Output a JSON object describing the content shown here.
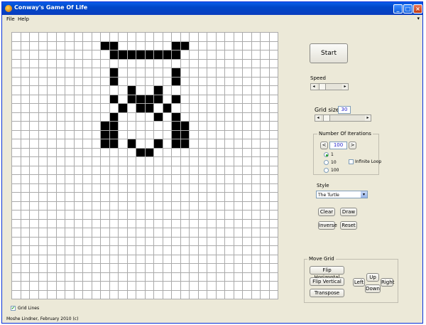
{
  "window": {
    "title": "Conway's Game Of Life"
  },
  "menu": {
    "file": "File",
    "help": "Help",
    "overflow": "▾"
  },
  "grid": {
    "size": 30,
    "alive": [
      [
        1,
        10
      ],
      [
        1,
        11
      ],
      [
        1,
        18
      ],
      [
        1,
        19
      ],
      [
        2,
        11
      ],
      [
        2,
        12
      ],
      [
        2,
        13
      ],
      [
        2,
        14
      ],
      [
        2,
        15
      ],
      [
        2,
        16
      ],
      [
        2,
        17
      ],
      [
        2,
        18
      ],
      [
        4,
        11
      ],
      [
        4,
        18
      ],
      [
        5,
        11
      ],
      [
        5,
        18
      ],
      [
        6,
        13
      ],
      [
        6,
        16
      ],
      [
        7,
        11
      ],
      [
        7,
        13
      ],
      [
        7,
        14
      ],
      [
        7,
        15
      ],
      [
        7,
        16
      ],
      [
        7,
        18
      ],
      [
        8,
        12
      ],
      [
        8,
        14
      ],
      [
        8,
        15
      ],
      [
        8,
        17
      ],
      [
        9,
        11
      ],
      [
        9,
        16
      ],
      [
        9,
        18
      ],
      [
        10,
        10
      ],
      [
        10,
        11
      ],
      [
        10,
        18
      ],
      [
        10,
        19
      ],
      [
        11,
        10
      ],
      [
        11,
        11
      ],
      [
        11,
        18
      ],
      [
        11,
        19
      ],
      [
        12,
        10
      ],
      [
        12,
        11
      ],
      [
        12,
        13
      ],
      [
        12,
        16
      ],
      [
        12,
        18
      ],
      [
        12,
        19
      ],
      [
        13,
        14
      ],
      [
        13,
        15
      ]
    ]
  },
  "controls": {
    "start_label": "Start",
    "speed_label": "Speed",
    "speed_level": 0.1,
    "gridsize_label": "Grid size",
    "gridsize_value": "30",
    "gridsize_level": 0.05,
    "iterations": {
      "title": "Number Of Iterations",
      "prev": "<",
      "next": ">",
      "value": "100",
      "options": [
        "1",
        "10",
        "100"
      ],
      "selected": "1",
      "infinite_label": "Infinite Loop",
      "infinite_checked": false
    },
    "style_label": "Style",
    "style_value": "The Turtle",
    "clear_label": "Clear",
    "draw_label": "Draw",
    "inverse_label": "Inverse",
    "reset_label": "Reset",
    "move_grid": {
      "title": "Move Grid",
      "flip_horizontal": "Flip Horizontal",
      "flip_vertical": "Flip Vertical",
      "transpose": "Transpose",
      "up": "Up",
      "down": "Down",
      "left": "Left",
      "right": "Right"
    }
  },
  "footer": {
    "gridlines_label": "Grid Lines",
    "gridlines_checked": true,
    "credit": "Moshe Lindner, February 2010 (c)"
  }
}
